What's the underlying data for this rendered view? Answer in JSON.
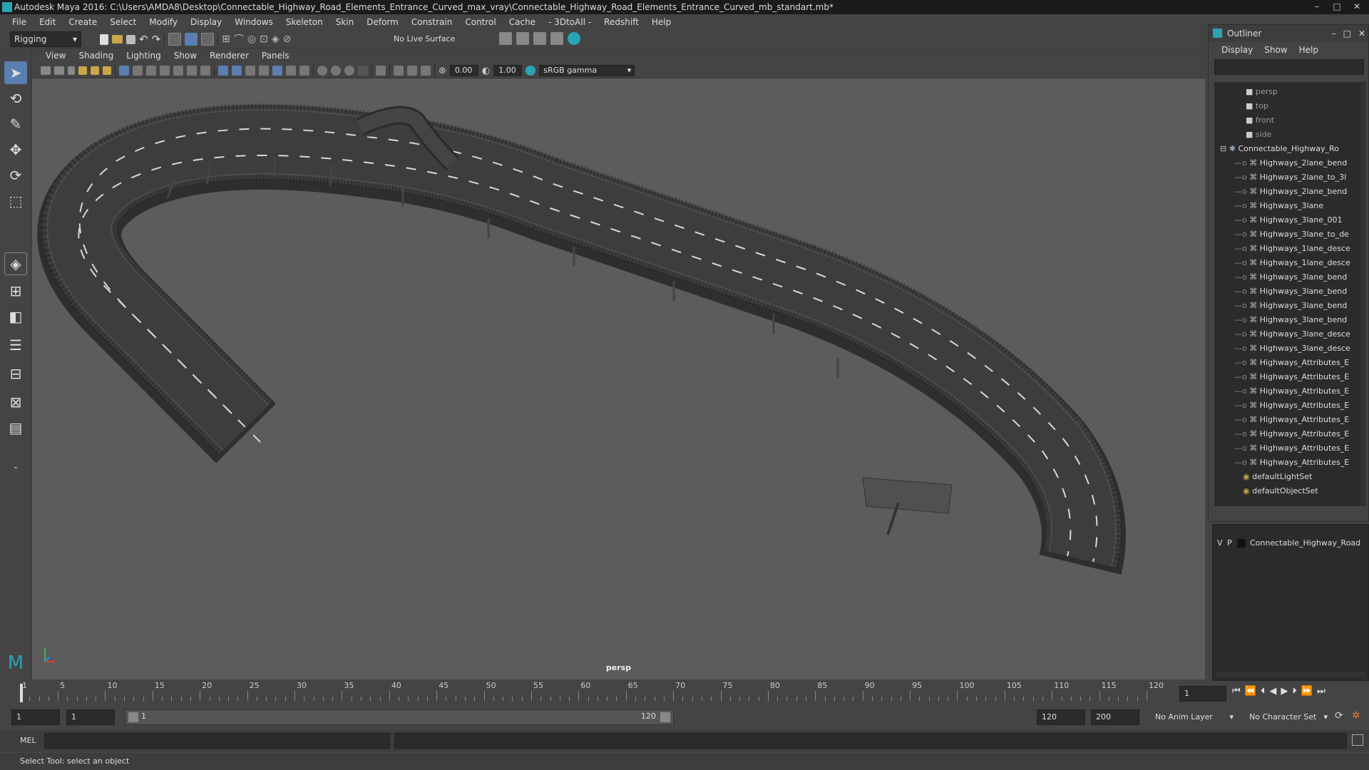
{
  "window": {
    "title": "Autodesk Maya 2016: C:\\Users\\AMDA8\\Desktop\\Connectable_Highway_Road_Elements_Entrance_Curved_max_vray\\Connectable_Highway_Road_Elements_Entrance_Curved_mb_standart.mb*",
    "controls": [
      "–",
      "□",
      "✕"
    ]
  },
  "menubar": [
    "File",
    "Edit",
    "Create",
    "Select",
    "Modify",
    "Display",
    "Windows",
    "Skeleton",
    "Skin",
    "Deform",
    "Constrain",
    "Control",
    "Cache",
    "- 3DtoAll -",
    "Redshift",
    "Help"
  ],
  "statusline": {
    "mode": "Rigging",
    "live_surface": "No Live Surface"
  },
  "panel": {
    "menus": [
      "View",
      "Shading",
      "Lighting",
      "Show",
      "Renderer",
      "Panels"
    ],
    "near_value": "0.00",
    "gamma_value": "1.00",
    "color_space": "sRGB gamma",
    "camera_label": "persp"
  },
  "outliner": {
    "title": "Outliner",
    "menus": [
      "Display",
      "Show",
      "Help"
    ],
    "cameras": [
      "persp",
      "top",
      "front",
      "side"
    ],
    "root": "Connectable_Highway_Ro",
    "children": [
      "Highways_2lane_bend",
      "Highways_2lane_to_3l",
      "Highways_2lane_bend",
      "Highways_3lane",
      "Highways_3lane_001",
      "Highways_3lane_to_de",
      "Highways_1lane_desce",
      "Highways_1lane_desce",
      "Highways_3lane_bend",
      "Highways_3lane_bend",
      "Highways_3lane_bend",
      "Highways_3lane_bend",
      "Highways_3lane_desce",
      "Highways_3lane_desce",
      "Highways_Attributes_E",
      "Highways_Attributes_E",
      "Highways_Attributes_E",
      "Highways_Attributes_E",
      "Highways_Attributes_E",
      "Highways_Attributes_E",
      "Highways_Attributes_E",
      "Highways_Attributes_E"
    ],
    "sets": [
      "defaultLightSet",
      "defaultObjectSet"
    ]
  },
  "layers": {
    "v": "V",
    "p": "P",
    "name": "Connectable_Highway_Road"
  },
  "timeline": {
    "ticks": [
      "1",
      "5",
      "10",
      "15",
      "20",
      "25",
      "30",
      "35",
      "40",
      "45",
      "50",
      "55",
      "60",
      "65",
      "70",
      "75",
      "80",
      "85",
      "90",
      "95",
      "100",
      "105",
      "110",
      "115",
      "120"
    ],
    "current_frame": "1"
  },
  "range": {
    "start": "1",
    "start_inner": "1",
    "slider_start": "1",
    "slider_end": "120",
    "end_inner": "120",
    "end": "200",
    "anim_layer": "No Anim Layer",
    "char_set": "No Character Set"
  },
  "mel": {
    "label": "MEL"
  },
  "helpline": "Select Tool: select an object",
  "colors": {
    "accent": "#2aa3b5",
    "active_tool": "#5a7fb0",
    "viewport_bg": "#5c5c5c",
    "road": "#3a3a3a"
  }
}
